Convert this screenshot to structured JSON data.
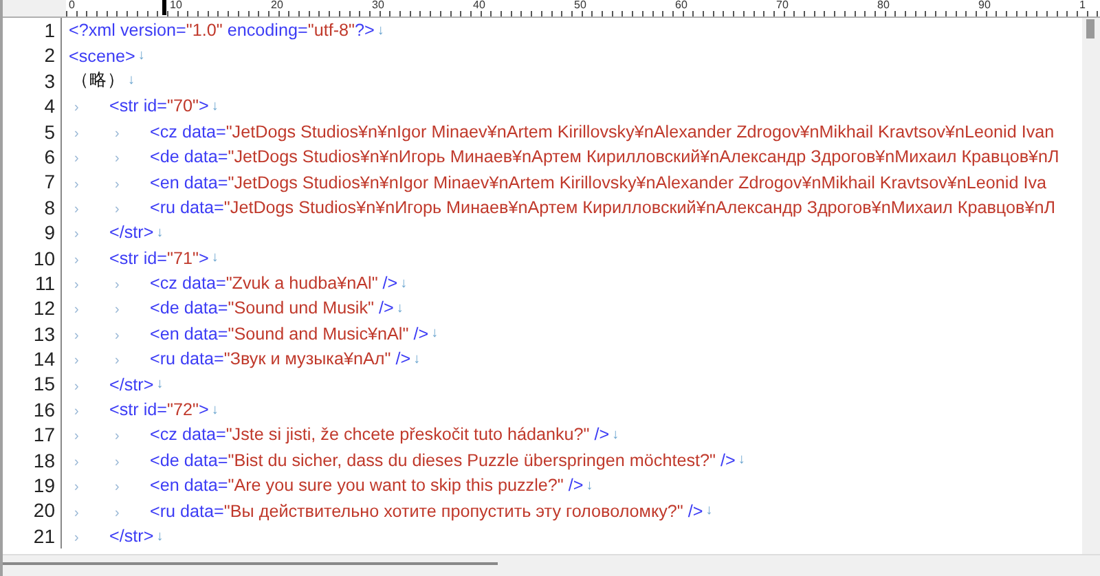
{
  "ruler": {
    "labels": [
      "0",
      "10",
      "20",
      "30",
      "40",
      "50",
      "60",
      "70",
      "80",
      "90",
      "1"
    ]
  },
  "lines": [
    {
      "number": "1",
      "tokens": [
        {
          "kind": "tag",
          "text": "<?xml version="
        },
        {
          "kind": "string",
          "text": "\"1.0\""
        },
        {
          "kind": "tag",
          "text": " encoding="
        },
        {
          "kind": "string",
          "text": "\"utf-8\""
        },
        {
          "kind": "tag",
          "text": "?>"
        }
      ],
      "eol": "↓"
    },
    {
      "number": "2",
      "tokens": [
        {
          "kind": "tag",
          "text": "<scene>"
        }
      ],
      "eol": "↓"
    },
    {
      "number": "3",
      "tokens": [
        {
          "kind": "plain",
          "text": "（略）"
        }
      ],
      "eol": "↓"
    },
    {
      "number": "4",
      "tabs": [
        "›"
      ],
      "tokens": [
        {
          "kind": "tag",
          "text": "<str id="
        },
        {
          "kind": "string",
          "text": "\"70\""
        },
        {
          "kind": "tag",
          "text": ">"
        }
      ],
      "eol": "↓"
    },
    {
      "number": "5",
      "tabs": [
        "›",
        "›"
      ],
      "tokens": [
        {
          "kind": "tag",
          "text": "<cz data="
        },
        {
          "kind": "string",
          "text": "\"JetDogs Studios¥n¥nIgor Minaev¥nArtem Kirillovsky¥nAlexander Zdrogov¥nMikhail Kravtsov¥nLeonid Ivan"
        }
      ]
    },
    {
      "number": "6",
      "tabs": [
        "›",
        "›"
      ],
      "tokens": [
        {
          "kind": "tag",
          "text": "<de data="
        },
        {
          "kind": "string",
          "text": "\"JetDogs Studios¥n¥nИгорь Минаев¥nАртем Кирилловский¥nАлександр Здрогов¥nМихаил Кравцов¥nЛ"
        }
      ]
    },
    {
      "number": "7",
      "tabs": [
        "›",
        "›"
      ],
      "tokens": [
        {
          "kind": "tag",
          "text": "<en data="
        },
        {
          "kind": "string",
          "text": "\"JetDogs Studios¥n¥nIgor Minaev¥nArtem Kirillovsky¥nAlexander Zdrogov¥nMikhail Kravtsov¥nLeonid Iva"
        }
      ]
    },
    {
      "number": "8",
      "tabs": [
        "›",
        "›"
      ],
      "tokens": [
        {
          "kind": "tag",
          "text": "<ru data="
        },
        {
          "kind": "string",
          "text": "\"JetDogs Studios¥n¥nИгорь Минаев¥nАртем Кирилловский¥nАлександр Здрогов¥nМихаил Кравцов¥nЛ"
        }
      ]
    },
    {
      "number": "9",
      "tabs": [
        "›"
      ],
      "tokens": [
        {
          "kind": "tag",
          "text": "</str>"
        }
      ],
      "eol": "↓"
    },
    {
      "number": "10",
      "tabs": [
        "›"
      ],
      "tokens": [
        {
          "kind": "tag",
          "text": "<str id="
        },
        {
          "kind": "string",
          "text": "\"71\""
        },
        {
          "kind": "tag",
          "text": ">"
        }
      ],
      "eol": "↓"
    },
    {
      "number": "11",
      "tabs": [
        "›",
        "›"
      ],
      "tokens": [
        {
          "kind": "tag",
          "text": "<cz data="
        },
        {
          "kind": "string",
          "text": "\"Zvuk a hudba¥nAl\""
        },
        {
          "kind": "tag",
          "text": " />"
        }
      ],
      "eol": "↓"
    },
    {
      "number": "12",
      "tabs": [
        "›",
        "›"
      ],
      "tokens": [
        {
          "kind": "tag",
          "text": "<de data="
        },
        {
          "kind": "string",
          "text": "\"Sound und Musik\""
        },
        {
          "kind": "tag",
          "text": " />"
        }
      ],
      "eol": "↓"
    },
    {
      "number": "13",
      "tabs": [
        "›",
        "›"
      ],
      "tokens": [
        {
          "kind": "tag",
          "text": "<en data="
        },
        {
          "kind": "string",
          "text": "\"Sound and Music¥nAl\""
        },
        {
          "kind": "tag",
          "text": " />"
        }
      ],
      "eol": "↓"
    },
    {
      "number": "14",
      "tabs": [
        "›",
        "›"
      ],
      "tokens": [
        {
          "kind": "tag",
          "text": "<ru data="
        },
        {
          "kind": "string",
          "text": "\"Звук и музыка¥nАл\""
        },
        {
          "kind": "tag",
          "text": " />"
        }
      ],
      "eol": "↓"
    },
    {
      "number": "15",
      "tabs": [
        "›"
      ],
      "tokens": [
        {
          "kind": "tag",
          "text": "</str>"
        }
      ],
      "eol": "↓"
    },
    {
      "number": "16",
      "tabs": [
        "›"
      ],
      "tokens": [
        {
          "kind": "tag",
          "text": "<str id="
        },
        {
          "kind": "string",
          "text": "\"72\""
        },
        {
          "kind": "tag",
          "text": ">"
        }
      ],
      "eol": "↓"
    },
    {
      "number": "17",
      "tabs": [
        "›",
        "›"
      ],
      "tokens": [
        {
          "kind": "tag",
          "text": "<cz data="
        },
        {
          "kind": "string",
          "text": "\"Jste si jisti, že chcete přeskočit tuto hádanku?\""
        },
        {
          "kind": "tag",
          "text": " />"
        }
      ],
      "eol": "↓"
    },
    {
      "number": "18",
      "tabs": [
        "›",
        "›"
      ],
      "tokens": [
        {
          "kind": "tag",
          "text": "<de data="
        },
        {
          "kind": "string",
          "text": "\"Bist du sicher, dass du dieses Puzzle überspringen möchtest?\""
        },
        {
          "kind": "tag",
          "text": " />"
        }
      ],
      "eol": "↓"
    },
    {
      "number": "19",
      "tabs": [
        "›",
        "›"
      ],
      "tokens": [
        {
          "kind": "tag",
          "text": "<en data="
        },
        {
          "kind": "string",
          "text": "\"Are you sure you want to skip this puzzle?\""
        },
        {
          "kind": "tag",
          "text": " />"
        }
      ],
      "eol": "↓"
    },
    {
      "number": "20",
      "tabs": [
        "›",
        "›"
      ],
      "tokens": [
        {
          "kind": "tag",
          "text": "<ru data="
        },
        {
          "kind": "string",
          "text": "\"Вы действительно хотите пропустить эту головоломку?\""
        },
        {
          "kind": "tag",
          "text": " />"
        }
      ],
      "eol": "↓"
    },
    {
      "number": "21",
      "tabs": [
        "›"
      ],
      "tokens": [
        {
          "kind": "tag",
          "text": "</str>"
        }
      ],
      "eol": "↓"
    }
  ]
}
